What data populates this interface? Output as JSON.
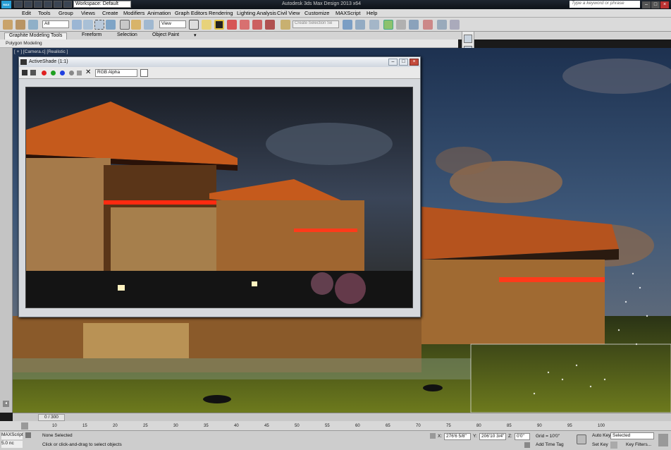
{
  "app": {
    "title": "Autodesk 3ds Max Design 2013 x64",
    "workspace": "Workspace: Default",
    "help_search_placeholder": "Type a keyword or phrase",
    "logo": "MAX"
  },
  "menu": [
    "Edit",
    "Tools",
    "Group",
    "Views",
    "Create",
    "Modifiers",
    "Animation",
    "Graph Editors",
    "Rendering",
    "Lighting Analysis",
    "Civil View",
    "Customize",
    "MAXScript",
    "Help"
  ],
  "toolbar": {
    "selection_filter": "All",
    "ref_coord": "View",
    "named_selection_placeholder": "Create Selection Se"
  },
  "ribbon": {
    "tabs": [
      "Graphite Modeling Tools",
      "Freeform",
      "Selection",
      "Object Paint"
    ],
    "panel_label": "Polygon Modeling"
  },
  "viewport": {
    "label": "[ + ] [Camera.c] [Realistic ]"
  },
  "activeshade": {
    "title": "ActiveShade (1:1)",
    "channel": "RGB Alpha"
  },
  "timeline": {
    "frame_display": "0 / 300",
    "ticks": [
      "10",
      "15",
      "20",
      "25",
      "30",
      "35",
      "40",
      "45",
      "50",
      "55",
      "60",
      "65",
      "70",
      "75",
      "80",
      "85",
      "90",
      "95",
      "100"
    ]
  },
  "status": {
    "script_label": "MAXScript",
    "script_label2": "5.0 nc",
    "selection": "None Selected",
    "prompt": "Click or click-and-drag to select objects",
    "x_label": "X:",
    "x_value": "276'6 5/8\"",
    "y_label": "Y:",
    "y_value": "206'10 3/4\"",
    "z_label": "Z:",
    "z_value": "0'0\"",
    "grid": "Grid = 10'0\"",
    "add_time_tag": "Add Time Tag",
    "auto_key": "Auto Key",
    "set_key": "Set Key",
    "key_mode": "Selected",
    "key_filters": "Key Filters..."
  }
}
